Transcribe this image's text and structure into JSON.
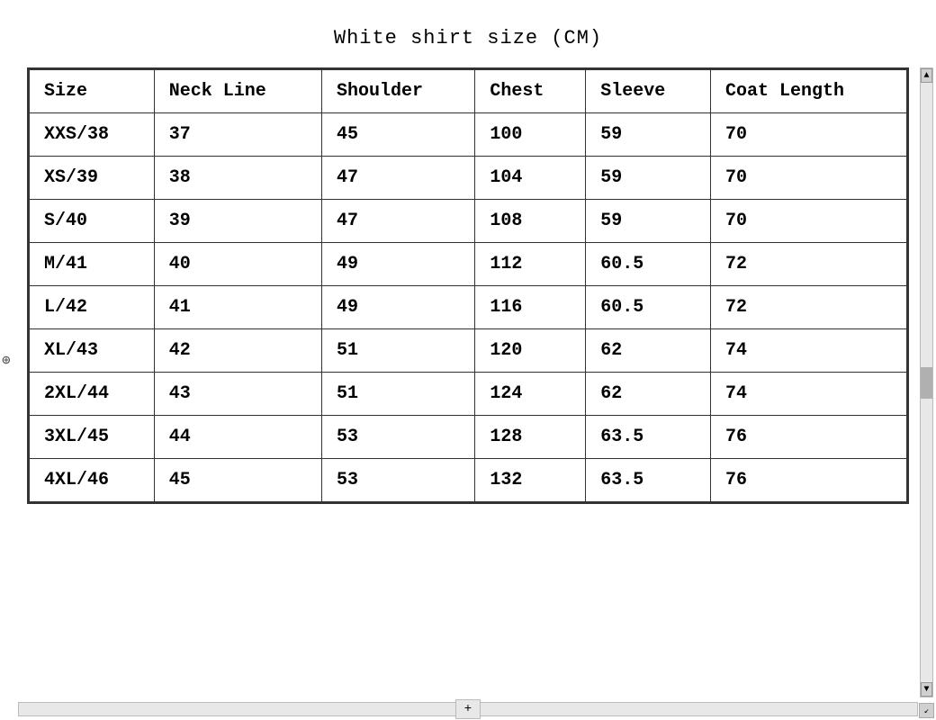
{
  "title": "White shirt size (CM)",
  "table": {
    "headers": [
      "Size",
      "Neck Line",
      "Shoulder",
      "Chest",
      "Sleeve",
      "Coat Length"
    ],
    "rows": [
      [
        "XXS/38",
        "37",
        "45",
        "100",
        "59",
        "70"
      ],
      [
        "XS/39",
        "38",
        "47",
        "104",
        "59",
        "70"
      ],
      [
        "S/40",
        "39",
        "47",
        "108",
        "59",
        "70"
      ],
      [
        "M/41",
        "40",
        "49",
        "112",
        "60.5",
        "72"
      ],
      [
        "L/42",
        "41",
        "49",
        "116",
        "60.5",
        "72"
      ],
      [
        "XL/43",
        "42",
        "51",
        "120",
        "62",
        "74"
      ],
      [
        "2XL/44",
        "43",
        "51",
        "124",
        "62",
        "74"
      ],
      [
        "3XL/45",
        "44",
        "53",
        "128",
        "63.5",
        "76"
      ],
      [
        "4XL/46",
        "45",
        "53",
        "132",
        "63.5",
        "76"
      ]
    ]
  },
  "scrollbar": {
    "plus_label": "+",
    "corner_label": "↙"
  }
}
